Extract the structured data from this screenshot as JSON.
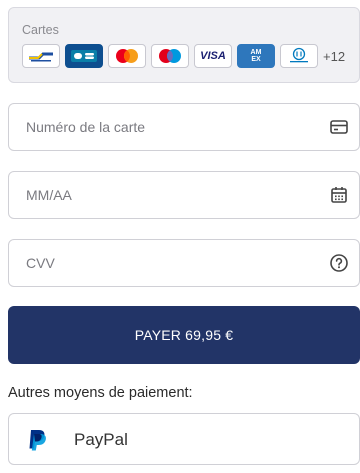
{
  "cards": {
    "label": "Cartes",
    "logos": [
      {
        "name": "bancontact",
        "text": ""
      },
      {
        "name": "cartes-bancaires",
        "text": "CB"
      },
      {
        "name": "mastercard",
        "text": ""
      },
      {
        "name": "maestro",
        "text": ""
      },
      {
        "name": "visa",
        "text": "VISA"
      },
      {
        "name": "american-express",
        "text": "AM EX"
      },
      {
        "name": "diners-club",
        "text": ""
      }
    ],
    "more_count": "+12"
  },
  "fields": {
    "card_number_placeholder": "Numéro de la carte",
    "expiry_placeholder": "MM/AA",
    "cvv_placeholder": "CVV"
  },
  "pay_button_label": "PAYER 69,95 €",
  "other_methods": {
    "label": "Autres moyens de paiement:",
    "paypal_label": "PayPal"
  },
  "colors": {
    "accent": "#223467",
    "paypal_dark": "#003087",
    "paypal_light": "#009cde"
  },
  "icons": {
    "card_field": "credit-card-icon",
    "expiry_field": "calendar-icon",
    "cvv_field": "help-circle-icon",
    "paypal": "paypal-icon"
  }
}
